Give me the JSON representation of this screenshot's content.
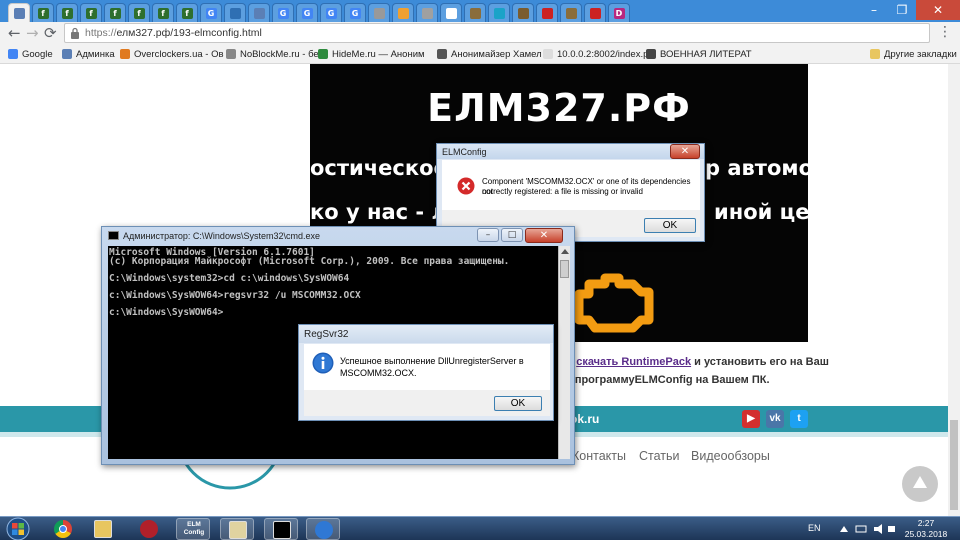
{
  "browser": {
    "tabs": [
      {
        "fav": "",
        "color": "#5b7fb5"
      },
      {
        "fav": "f",
        "color": "#2e6f2e"
      },
      {
        "fav": "f",
        "color": "#2e6f2e"
      },
      {
        "fav": "f",
        "color": "#2e6f2e"
      },
      {
        "fav": "f",
        "color": "#2e6f2e"
      },
      {
        "fav": "f",
        "color": "#2e6f2e"
      },
      {
        "fav": "f",
        "color": "#2e6f2e"
      },
      {
        "fav": "f",
        "color": "#2e6f2e"
      },
      {
        "fav": "G",
        "color": "#4285f4"
      },
      {
        "fav": "",
        "color": "#2f6fb3"
      },
      {
        "fav": "",
        "color": "#5b7fb5"
      },
      {
        "fav": "G",
        "color": "#4285f4"
      },
      {
        "fav": "G",
        "color": "#4285f4"
      },
      {
        "fav": "G",
        "color": "#4285f4"
      },
      {
        "fav": "G",
        "color": "#4285f4"
      },
      {
        "fav": "",
        "color": "#999999"
      },
      {
        "fav": "",
        "color": "#f0a030"
      },
      {
        "fav": "",
        "color": "#a0a0a0"
      },
      {
        "fav": "",
        "color": "#ffffff"
      },
      {
        "fav": "",
        "color": "#8a6d3b"
      },
      {
        "fav": "",
        "color": "#1aa3c8"
      },
      {
        "fav": "",
        "color": "#7a5c2e"
      },
      {
        "fav": "",
        "color": "#cc2222"
      },
      {
        "fav": "",
        "color": "#8a6d3b"
      },
      {
        "fav": "",
        "color": "#cc2222"
      },
      {
        "fav": "D",
        "color": "#b8287f"
      }
    ],
    "window_buttons": {
      "minimize": "–",
      "maximize": "❐",
      "close": "✕"
    },
    "nav": {
      "back": "←",
      "forward": "→",
      "reload": "⟳"
    },
    "url": {
      "scheme": "https://",
      "rest": "елм327.рф/193-elmconfig.html"
    },
    "menu": "⋮",
    "bookmarks": [
      {
        "label": "Google",
        "color": "#4285f4"
      },
      {
        "label": "Админка",
        "color": "#5b7fb5"
      },
      {
        "label": "Overclockers.ua - Ов",
        "color": "#e07a20"
      },
      {
        "label": "NoBlockMe.ru - бесп",
        "color": "#888888"
      },
      {
        "label": "HideMe.ru — Аноним",
        "color": "#2e8b3e"
      },
      {
        "label": "Анонимайзер Хамел",
        "color": "#555555"
      },
      {
        "label": "10.0.0.2:8002/index.p",
        "color": "#dddddd"
      },
      {
        "label": "ВОЕННАЯ ЛИТЕРАТ",
        "color": "#444444"
      }
    ],
    "other_bookmarks": "Другие закладки"
  },
  "page": {
    "hero_title": "ЕЛМ327.РФ",
    "hero_line1_left": "остическое с",
    "hero_line1_right": "р автомоб",
    "hero_line2_left": "ко у нас - лу",
    "hero_line2_right": "иной цене",
    "info1_text": "м",
    "info1_link": "скачать RuntimePack",
    "info1_rest": "и установить его на Ваш",
    "info2": "ь программуELMConfig на Вашем ПК.",
    "site_suffix": "ok.ru",
    "social": [
      {
        "name": "YouTube",
        "glyph": "▶",
        "color": "#d32f2f"
      },
      {
        "name": "VK",
        "glyph": "vk",
        "color": "#4a76a8"
      },
      {
        "name": "Twitter",
        "glyph": "t",
        "color": "#1da1f2"
      }
    ],
    "footer_nav": [
      "Контакты",
      "Статьи",
      "Видеообзоры"
    ]
  },
  "elmconfig_dialog": {
    "title": "ELMConfig",
    "message_line1": "Component 'MSCOMM32.OCX' or one of its dependencies not",
    "message_line2": "correctly registered: a file is missing or invalid",
    "ok": "OK",
    "close": "✕"
  },
  "cmd_window": {
    "title": "Администратор: C:\\Windows\\System32\\cmd.exe",
    "lines": [
      "Microsoft Windows [Version 6.1.7601]",
      "(c) Корпорация Майкрософт (Microsoft Corp.), 2009. Все права защищены.",
      "",
      "C:\\Windows\\system32>cd c:\\windows\\SysWOW64",
      "",
      "c:\\Windows\\SysWOW64>regsvr32 /u MSCOMM32.OCX",
      "",
      "c:\\Windows\\SysWOW64>"
    ],
    "minimize": "–",
    "maximize": "□",
    "close": "✕"
  },
  "regsvr_dialog": {
    "title": "RegSvr32",
    "message_line1": "Успешное выполнение DllUnregisterServer в",
    "message_line2": "MSCOMM32.OCX.",
    "ok": "OK"
  },
  "taskbar": {
    "apps": [
      {
        "name": "chrome"
      },
      {
        "name": "explorer"
      },
      {
        "name": "app-red"
      },
      {
        "name": "elm-config",
        "label": "ELM Config"
      },
      {
        "name": "paint"
      },
      {
        "name": "cmd"
      },
      {
        "name": "info"
      }
    ],
    "lang": "EN",
    "time": "2:27",
    "date": "25.03.2018"
  }
}
